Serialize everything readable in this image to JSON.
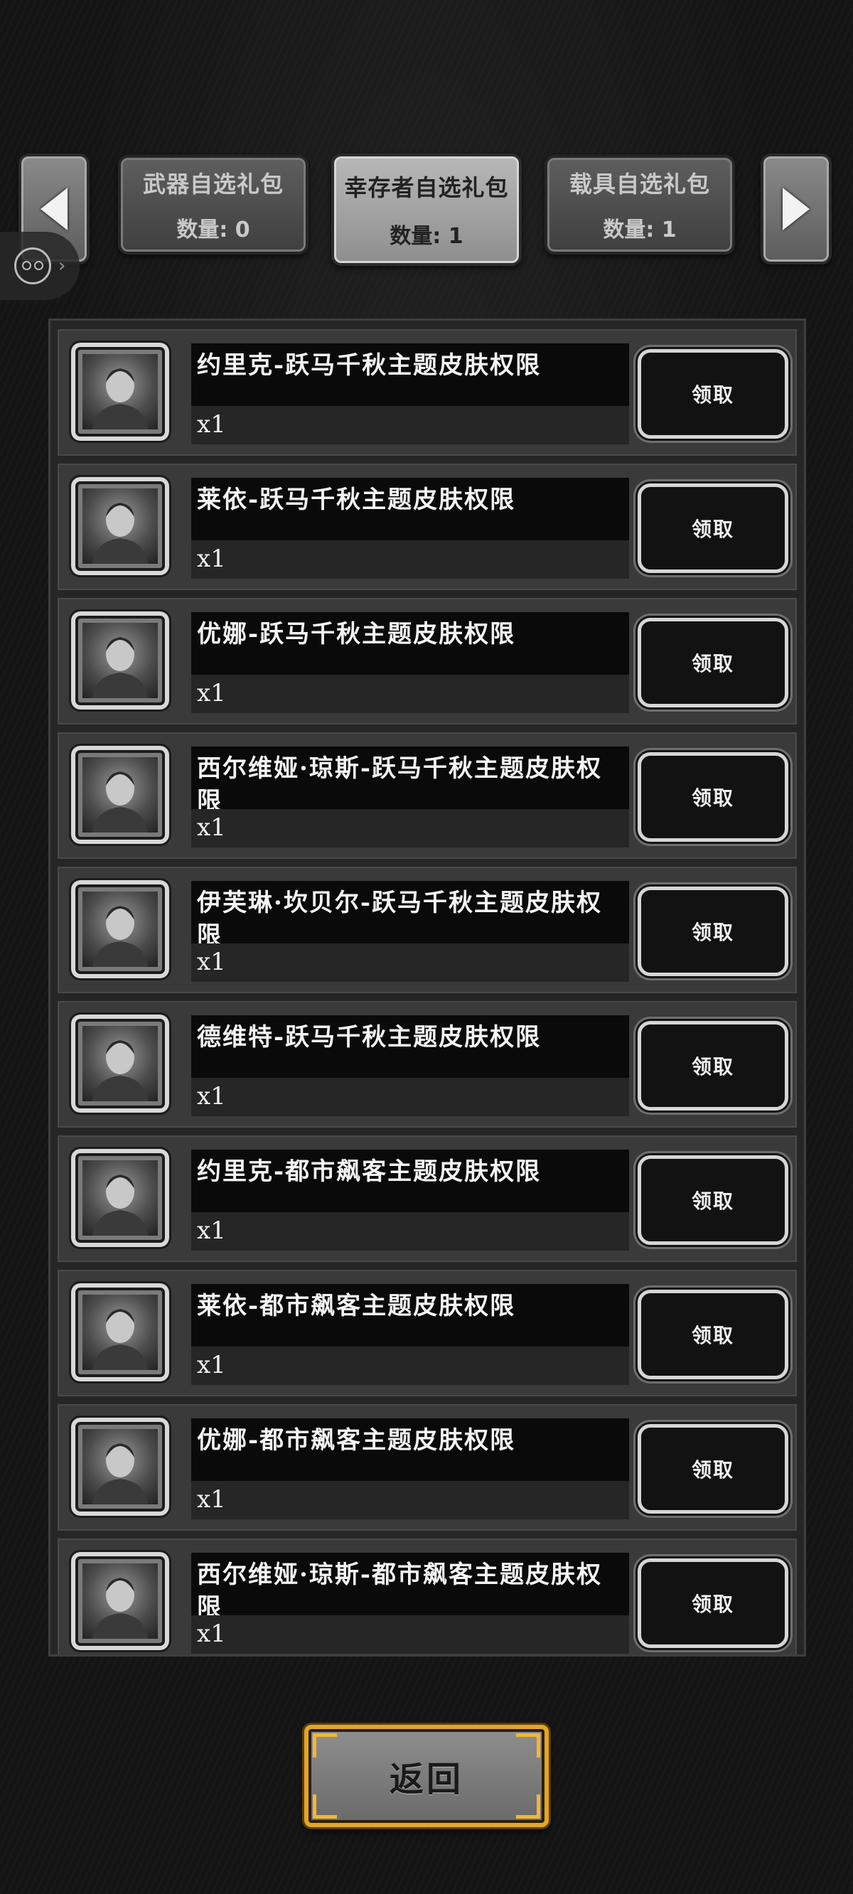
{
  "tabs": {
    "prev_arrow": "left-arrow-icon",
    "next_arrow": "right-arrow-icon",
    "items": [
      {
        "name": "武器自选礼包",
        "count": "数量: 0"
      },
      {
        "name": "幸存者自选礼包",
        "count": "数量: 1"
      },
      {
        "name": "载具自选礼包",
        "count": "数量: 1"
      }
    ],
    "active_index": 1
  },
  "assistant": {
    "icon": "assistant-face-icon",
    "chevron": "›"
  },
  "rewards": [
    {
      "title": "约里克-跃马千秋主题皮肤权限",
      "qty": "x1",
      "button": "领取"
    },
    {
      "title": "莱依-跃马千秋主题皮肤权限",
      "qty": "x1",
      "button": "领取"
    },
    {
      "title": "优娜-跃马千秋主题皮肤权限",
      "qty": "x1",
      "button": "领取"
    },
    {
      "title": "西尔维娅·琼斯-跃马千秋主题皮肤权限",
      "qty": "x1",
      "button": "领取"
    },
    {
      "title": "伊芙琳·坎贝尔-跃马千秋主题皮肤权限",
      "qty": "x1",
      "button": "领取"
    },
    {
      "title": "德维特-跃马千秋主题皮肤权限",
      "qty": "x1",
      "button": "领取"
    },
    {
      "title": "约里克-都市飙客主题皮肤权限",
      "qty": "x1",
      "button": "领取"
    },
    {
      "title": "莱依-都市飙客主题皮肤权限",
      "qty": "x1",
      "button": "领取"
    },
    {
      "title": "优娜-都市飙客主题皮肤权限",
      "qty": "x1",
      "button": "领取"
    },
    {
      "title": "西尔维娅·琼斯-都市飙客主题皮肤权限",
      "qty": "x1",
      "button": "领取"
    }
  ],
  "back_button": "返回",
  "colors": {
    "gold_border": "#e2a52d",
    "panel": "#262626",
    "row": "#3a3a3a"
  }
}
